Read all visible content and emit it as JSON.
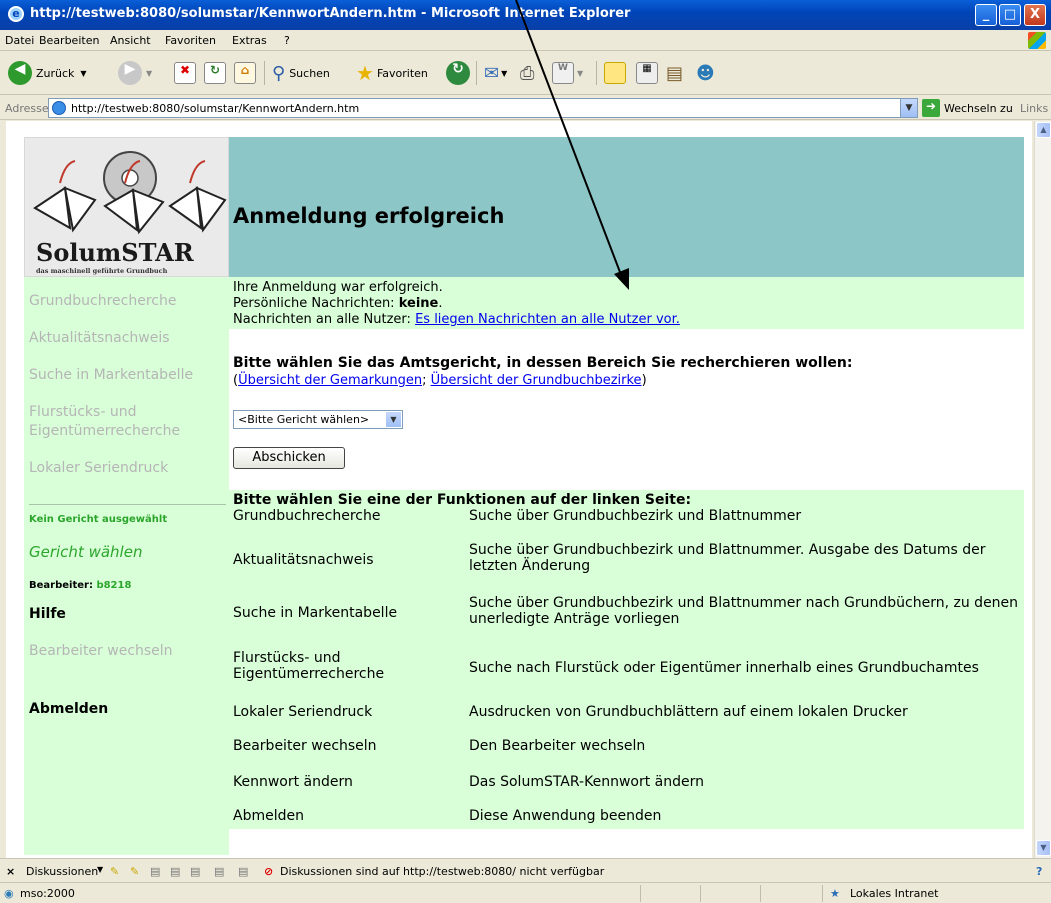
{
  "window": {
    "title": "http://testweb:8080/solumstar/KennwortAndern.htm - Microsoft Internet Explorer",
    "minimize_glyph": "_",
    "maximize_glyph": "□",
    "close_glyph": "X"
  },
  "menu": [
    "Datei",
    "Bearbeiten",
    "Ansicht",
    "Favoriten",
    "Extras",
    "?"
  ],
  "toolbar": {
    "back_label": "Zurück",
    "search_label": "Suchen",
    "favorites_label": "Favoriten"
  },
  "address": {
    "label": "Adresse",
    "url": "http://testweb:8080/solumstar/KennwortAndern.htm",
    "go_label": "Wechseln zu",
    "links_label": "Links"
  },
  "banner": {
    "logo_text": "SolumSTAR",
    "logo_subtitle": "das maschinell geführte Grundbuch",
    "title": "Anmeldung erfolgreich"
  },
  "sidebar": {
    "links": [
      "Grundbuchrecherche",
      "Aktualitätsnachweis",
      "Suche in Markentabelle",
      "Flurstücks- und",
      "Eigentümerrecherche",
      "Lokaler Seriendruck"
    ],
    "court_status": "Kein Gericht ausgewählt",
    "choose_court": "Gericht wählen",
    "editor_label": "Bearbeiter:",
    "editor_value": "b8218",
    "help": "Hilfe",
    "change_editor": "Bearbeiter wechseln",
    "logout": "Abmelden"
  },
  "messages": {
    "line1": "Ihre Anmeldung war erfolgreich.",
    "line2_prefix": "Persönliche Nachrichten:",
    "line2_value": "keine",
    "line2_suffix": ".",
    "line3_prefix": "Nachrichten an alle Nutzer:",
    "line3_link": "Es liegen Nachrichten an alle Nutzer vor."
  },
  "court_selection": {
    "heading": "Bitte wählen Sie das Amtsgericht, in dessen Bereich Sie recherchieren wollen:",
    "open_paren": "(",
    "link1": "Übersicht der Gemarkungen",
    "separator": ";",
    "link2": "Übersicht der Grundbuchbezirke",
    "close_paren": ")",
    "select_value": "<Bitte Gericht wählen>",
    "submit_label": "Abschicken"
  },
  "functions": {
    "heading": "Bitte wählen Sie eine der Funktionen auf der linken Seite:",
    "rows": [
      {
        "name": "Grundbuchrecherche",
        "desc": "Suche über Grundbuchbezirk und Blattnummer"
      },
      {
        "name": "Aktualitätsnachweis",
        "desc": "Suche über Grundbuchbezirk und Blattnummer. Ausgabe des Datums der letzten Änderung"
      },
      {
        "name": "Suche in Markentabelle",
        "desc": "Suche über Grundbuchbezirk und Blattnummer nach Grundbüchern, zu denen unerledigte Anträge vorliegen"
      },
      {
        "name": "Flurstücks- und Eigentümerrecherche",
        "desc": "Suche nach Flurstück oder Eigentümer innerhalb eines Grundbuchamtes"
      },
      {
        "name": "Lokaler Seriendruck",
        "desc": "Ausdrucken von Grundbuchblättern auf einem lokalen Drucker"
      },
      {
        "name": "Bearbeiter wechseln",
        "desc": "Den Bearbeiter wechseln"
      },
      {
        "name": "Kennwort ändern",
        "desc": "Das SolumSTAR-Kennwort ändern"
      },
      {
        "name": "Abmelden",
        "desc": "Diese Anwendung beenden"
      }
    ]
  },
  "discussions": {
    "close_glyph": "×",
    "label": "Diskussionen",
    "status": "Diskussionen sind auf http://testweb:8080/ nicht verfügbar"
  },
  "status": {
    "left": "mso:2000",
    "zone": "Lokales Intranet"
  },
  "colors": {
    "sidebar_bg": "#d9ffd9",
    "banner_bg": "#8cc6c6",
    "accent_green": "#2ca52c",
    "disabled_gray": "#b5b5b5"
  }
}
